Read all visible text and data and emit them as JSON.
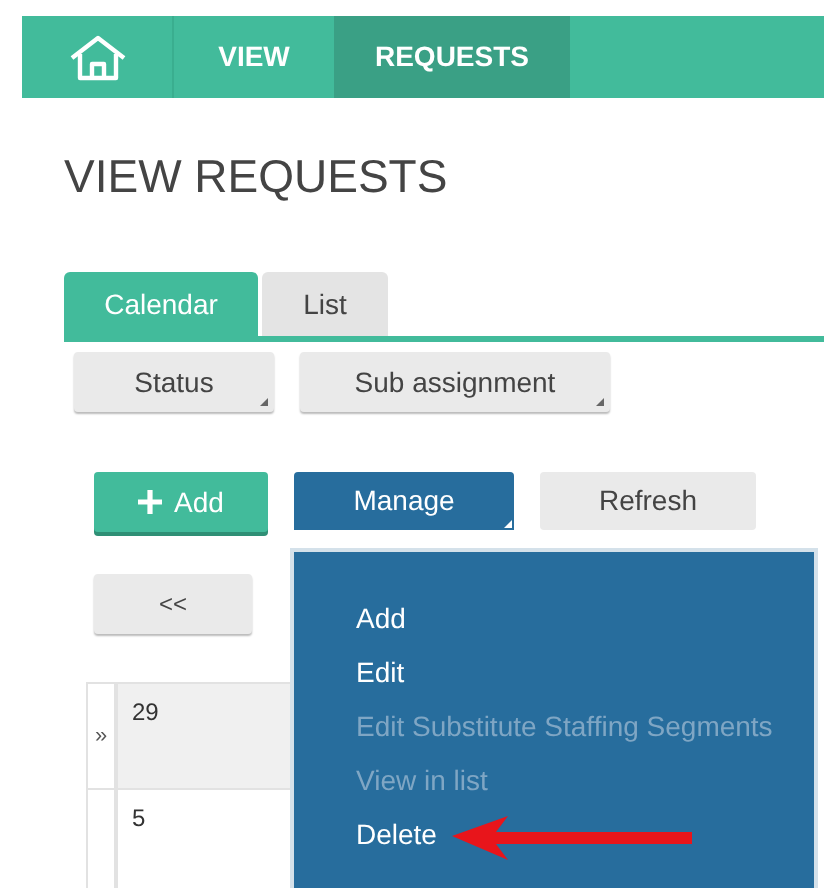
{
  "nav": {
    "items": [
      {
        "label": "VIEW",
        "selected": false
      },
      {
        "label": "REQUESTS",
        "selected": true
      }
    ]
  },
  "title": "VIEW REQUESTS",
  "tabs": [
    {
      "label": "Calendar",
      "selected": true
    },
    {
      "label": "List",
      "selected": false
    }
  ],
  "filters": [
    "Status",
    "Sub assignment"
  ],
  "toolbar": {
    "add": "Add",
    "manage": "Manage",
    "refresh": "Refresh"
  },
  "manage_menu": [
    {
      "label": "Add",
      "disabled": false
    },
    {
      "label": "Edit",
      "disabled": false
    },
    {
      "label": "Edit Substitute Staffing Segments",
      "disabled": true
    },
    {
      "label": "View in list",
      "disabled": true
    },
    {
      "label": "Delete",
      "disabled": false
    }
  ],
  "pager": {
    "previous": "<<"
  },
  "calendar": {
    "rows": [
      {
        "marker": "»",
        "day": "29",
        "shaded": true
      },
      {
        "marker": "",
        "day": "5",
        "shaded": false
      }
    ]
  }
}
